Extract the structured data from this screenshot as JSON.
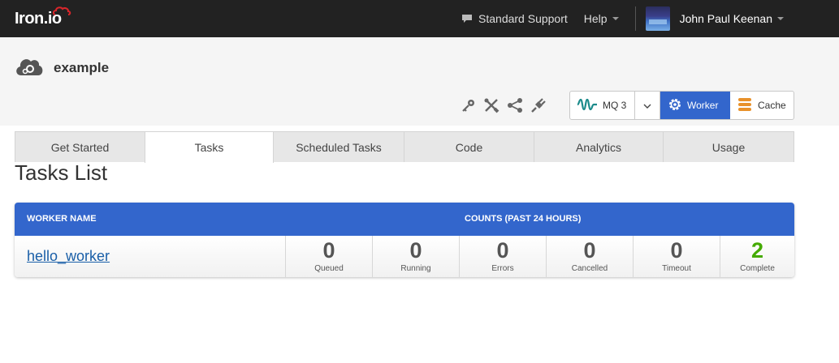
{
  "navbar": {
    "logo": "Iron.io",
    "support_label": "Standard Support",
    "help_label": "Help",
    "user_name": "John Paul Keenan"
  },
  "project": {
    "name": "example",
    "services": {
      "mq_label": "MQ 3",
      "worker_label": "Worker",
      "cache_label": "Cache"
    }
  },
  "tabs": [
    {
      "label": "Get Started"
    },
    {
      "label": "Tasks"
    },
    {
      "label": "Scheduled Tasks"
    },
    {
      "label": "Code"
    },
    {
      "label": "Analytics"
    },
    {
      "label": "Usage"
    }
  ],
  "main": {
    "title": "Tasks List",
    "table": {
      "col_worker": "WORKER NAME",
      "col_counts": "COUNTS (PAST 24 HOURS)",
      "row": {
        "worker_name": "hello_worker",
        "counts": [
          {
            "value": "0",
            "label": "Queued"
          },
          {
            "value": "0",
            "label": "Running"
          },
          {
            "value": "0",
            "label": "Errors"
          },
          {
            "value": "0",
            "label": "Cancelled"
          },
          {
            "value": "0",
            "label": "Timeout"
          },
          {
            "value": "2",
            "label": "Complete"
          }
        ]
      }
    }
  },
  "colors": {
    "navbar_bg": "#222222",
    "accent_blue": "#3366cc",
    "complete_green": "#44aa00",
    "mq_teal": "#1a8a8a",
    "cache_orange": "#e8912a"
  }
}
